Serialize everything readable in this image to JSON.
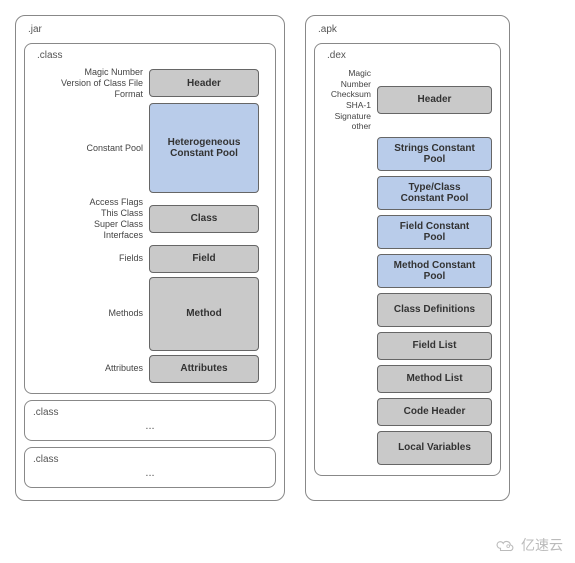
{
  "jar": {
    "label": ".jar",
    "class_label": ".class",
    "rows": [
      {
        "side": "Magic Number\nVersion of Class File Format",
        "text": "Header",
        "cls": "gray",
        "h": "h-sm"
      },
      {
        "side": "Constant Pool",
        "text": "Heterogeneous Constant Pool",
        "cls": "blue",
        "h": "h-xl"
      },
      {
        "side": "Access Flags\nThis Class\nSuper Class\nInterfaces",
        "text": "Class",
        "cls": "gray",
        "h": "h-sm"
      },
      {
        "side": "Fields",
        "text": "Field",
        "cls": "gray",
        "h": "h-sm"
      },
      {
        "side": "Methods",
        "text": "Method",
        "cls": "gray",
        "h": "h-lg"
      },
      {
        "side": "Attributes",
        "text": "Attributes",
        "cls": "gray",
        "h": "h-sm"
      }
    ],
    "extra1": {
      "label": ".class",
      "dots": "..."
    },
    "extra2": {
      "label": ".class",
      "dots": "..."
    }
  },
  "apk": {
    "label": ".apk",
    "dex_label": ".dex",
    "side": "Magic Number\nChecksum\nSHA-1 Signature\nother",
    "blocks": [
      {
        "text": "Header",
        "cls": "gray"
      },
      {
        "text": "Strings Constant Pool",
        "cls": "blue"
      },
      {
        "text": "Type/Class Constant Pool",
        "cls": "blue"
      },
      {
        "text": "Field Constant Pool",
        "cls": "blue"
      },
      {
        "text": "Method Constant Pool",
        "cls": "blue"
      },
      {
        "text": "Class Definitions",
        "cls": "gray"
      },
      {
        "text": "Field List",
        "cls": "gray"
      },
      {
        "text": "Method List",
        "cls": "gray"
      },
      {
        "text": "Code Header",
        "cls": "gray"
      },
      {
        "text": "Local Variables",
        "cls": "gray"
      }
    ]
  },
  "watermark": "亿速云"
}
